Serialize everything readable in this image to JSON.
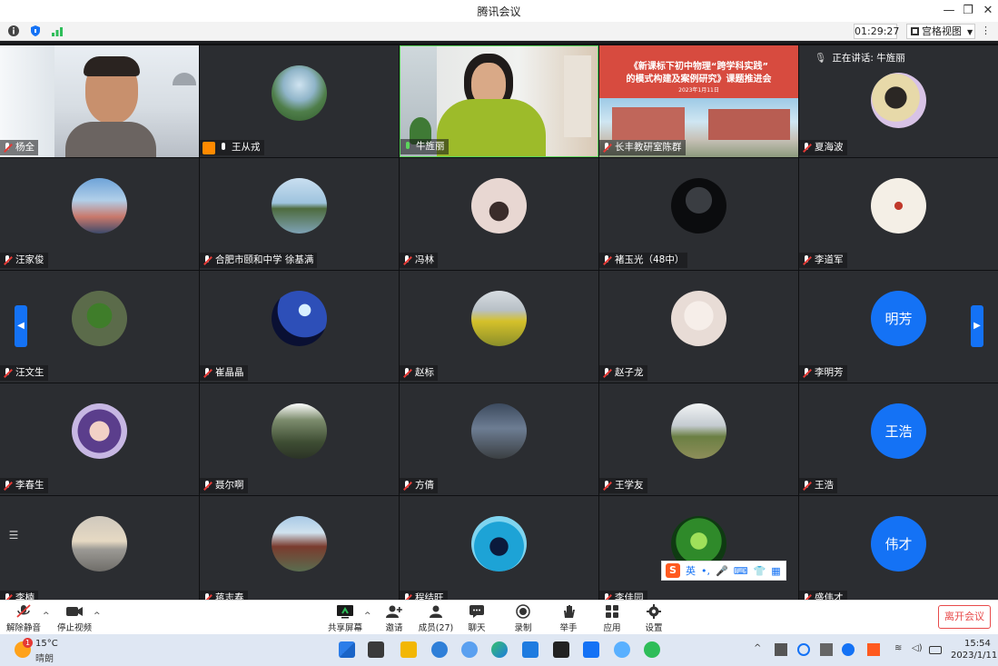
{
  "window": {
    "title": "腾讯会议"
  },
  "status": {
    "timer": "01:29:27",
    "view_label": "宫格视图"
  },
  "speaking": {
    "label": "正在讲话: 牛旌丽"
  },
  "participants": [
    {
      "name": "杨全",
      "avatar_text": ""
    },
    {
      "name": "王从戎",
      "avatar_text": ""
    },
    {
      "name": "牛旌丽",
      "avatar_text": ""
    },
    {
      "name": "长丰教研室陈群",
      "avatar_text": ""
    },
    {
      "name": "夏海波",
      "avatar_text": ""
    },
    {
      "name": "汪家俊",
      "avatar_text": ""
    },
    {
      "name": "合肥市颐和中学 徐基满",
      "avatar_text": ""
    },
    {
      "name": "冯林",
      "avatar_text": ""
    },
    {
      "name": "褚玉光（48中）",
      "avatar_text": ""
    },
    {
      "name": "李道军",
      "avatar_text": ""
    },
    {
      "name": "汪文生",
      "avatar_text": ""
    },
    {
      "name": "崔晶晶",
      "avatar_text": ""
    },
    {
      "name": "赵标",
      "avatar_text": ""
    },
    {
      "name": "赵子龙",
      "avatar_text": ""
    },
    {
      "name": "李明芳",
      "avatar_text": "明芳"
    },
    {
      "name": "李春生",
      "avatar_text": ""
    },
    {
      "name": "聂尔啊",
      "avatar_text": ""
    },
    {
      "name": "方倩",
      "avatar_text": ""
    },
    {
      "name": "王学友",
      "avatar_text": ""
    },
    {
      "name": "王浩",
      "avatar_text": "王浩"
    },
    {
      "name": "李楠",
      "avatar_text": ""
    },
    {
      "name": "蒋志春",
      "avatar_text": ""
    },
    {
      "name": "程结旺",
      "avatar_text": ""
    },
    {
      "name": "李佳园",
      "avatar_text": ""
    },
    {
      "name": "盛伟才",
      "avatar_text": "伟才"
    }
  ],
  "slide": {
    "title_line1": "《新课标下初中物理“跨学科实践”",
    "title_line2": "的模式构建及案例研究》课题推进会",
    "date": "2023年1月11日"
  },
  "ime": {
    "lang": "英"
  },
  "toolbar": {
    "unmute": "解除静音",
    "stop_video": "停止视频",
    "share": "共享屏幕",
    "invite": "邀请",
    "members": "成员(27)",
    "chat": "聊天",
    "record": "录制",
    "raise_hand": "举手",
    "apps": "应用",
    "settings": "设置",
    "leave": "离开会议"
  },
  "taskbar": {
    "weather_badge": "1",
    "temperature": "15°C",
    "weather": "晴朗",
    "time": "15:54",
    "date": "2023/1/11"
  },
  "colors": {
    "accent": "#1472f5",
    "leave": "#e84a4a",
    "tile_bg": "#2b2d31"
  }
}
